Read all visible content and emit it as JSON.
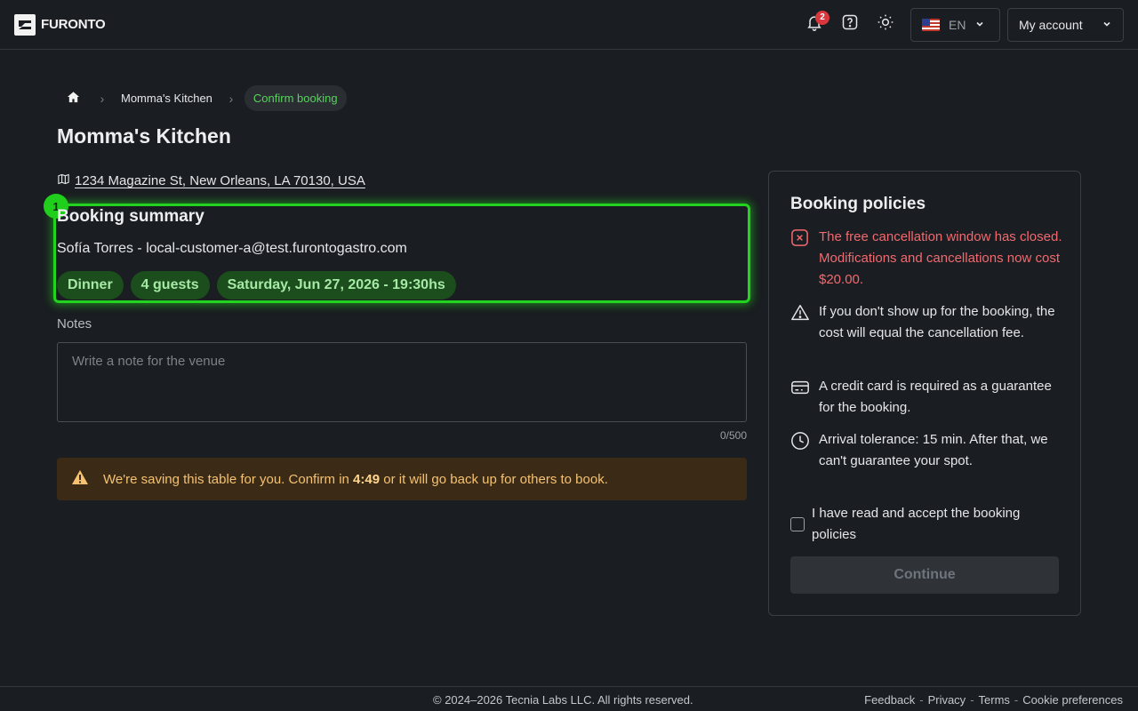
{
  "header": {
    "brand": "FURONTO",
    "notifications_count": "2",
    "language": "EN",
    "account_label": "My account",
    "icons": [
      "bell-icon",
      "help-icon",
      "sun-icon",
      "flag-us-icon",
      "chevron-down-icon"
    ]
  },
  "breadcrumb": {
    "items": [
      "Momma's Kitchen"
    ],
    "active": "Confirm booking"
  },
  "venue": {
    "name": "Momma's Kitchen",
    "address": "1234 Magazine St, New Orleans, LA 70130, USA"
  },
  "summary": {
    "marker": "1",
    "title": "Booking summary",
    "customer": "Sofía Torres - local-customer-a@test.furontogastro.com",
    "chips": [
      "Dinner",
      "4 guests",
      "Saturday, Jun 27, 2026 - 19:30hs"
    ]
  },
  "notes": {
    "label": "Notes",
    "placeholder": "Write a note for the venue",
    "counter": "0/500"
  },
  "alert": {
    "before": "We're saving this table for you. Confirm in",
    "time": "4:49",
    "after": "or it will go back up for others to book."
  },
  "policies": {
    "title": "Booking policies",
    "items": [
      "The free cancellation window has closed. Modifications and cancellations now cost $20.00.",
      "If you don't show up for the booking, the cost will equal the cancellation fee.",
      "A credit card is required as a guarantee for the booking.",
      "Arrival tolerance: 15 min. After that, we can't guarantee your spot."
    ],
    "accept_label": "I have read and accept the booking policies",
    "continue_label": "Continue"
  },
  "footer": {
    "copyright": "© 2024–2026 Tecnia Labs LLC. All rights reserved.",
    "links": [
      "Feedback",
      "Privacy",
      "Terms",
      "Cookie preferences"
    ]
  },
  "colors": {
    "background": "#1a1d21",
    "accent_green": "#22d31f",
    "danger": "#f16a6f",
    "warning": "#f4c271"
  }
}
